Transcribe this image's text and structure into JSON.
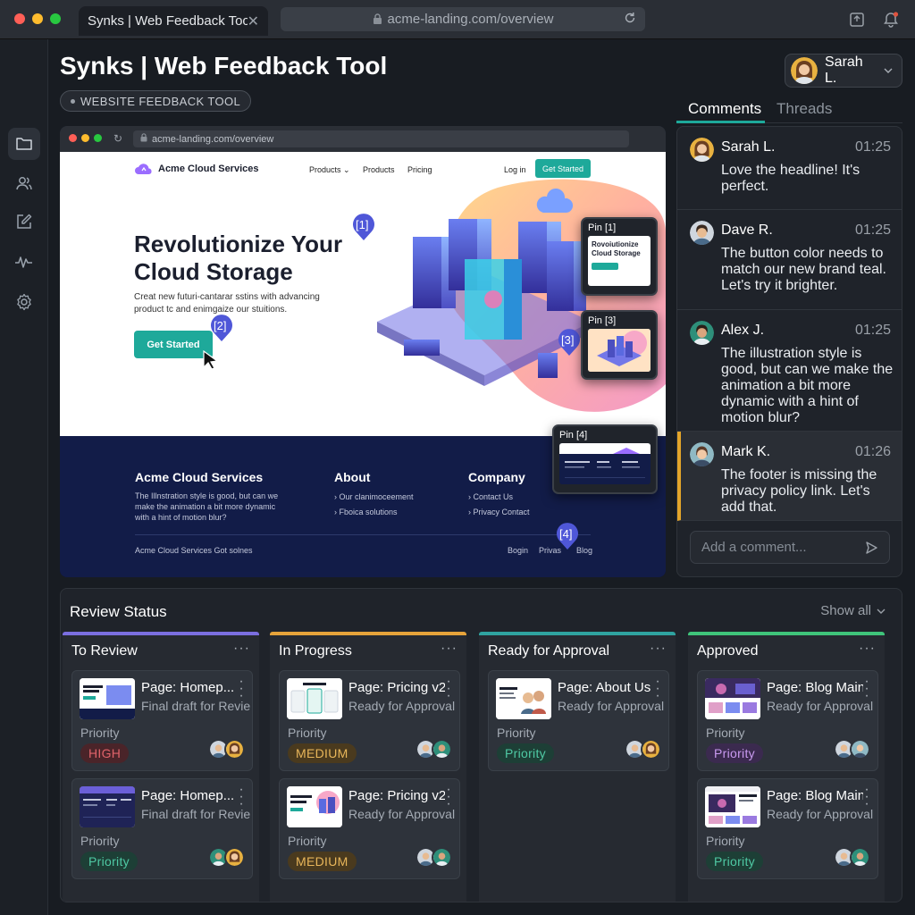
{
  "window": {
    "tab_title": "Synks | Web Feedback Tool",
    "url": "acme-landing.com/overview"
  },
  "app": {
    "title": "Synks | Web Feedback Tool",
    "chip": "WEBSITE FEEDBACK TOOL",
    "user_name": "Sarah L."
  },
  "preview": {
    "url": "acme-landing.com/overview",
    "site": {
      "brand": "Acme Cloud Services",
      "nav": [
        "Products",
        "Products",
        "Pricing"
      ],
      "login": "Log in",
      "cta": "Get Started",
      "hero_title": "Revolutionize Your Cloud Storage",
      "hero_body": "Creat new futuri-cantarar sstins with advancing product tc and enimgaize our stuitions.",
      "hero_button": "Get Started",
      "footer": {
        "brand_title": "Acme Cloud Services",
        "brand_text": "The Illnstration style is good, but can we make the animation a bit more dynamic with a hint of motion blur?",
        "about_title": "About",
        "about_links": [
          "Our clanimoceement",
          "Fboica solutions"
        ],
        "company_title": "Company",
        "company_links": [
          "Contact Us",
          "Privacy Contact"
        ],
        "bottom_left": "Acme Cloud Services   Got solnes",
        "bottom_links": [
          "Bogin",
          "Privas",
          "Blog"
        ]
      }
    },
    "pins": [
      {
        "marker": "[1]",
        "card_title": "Pin [1]",
        "card_text": "Rovoiutionize Cloud Storage"
      },
      {
        "marker": "[2]"
      },
      {
        "marker": "[3]",
        "card_title": "Pin [3]"
      },
      {
        "marker": "[4]",
        "card_title": "Pin [4]"
      }
    ]
  },
  "comments": {
    "tabs": [
      "Comments",
      "Threads"
    ],
    "items": [
      {
        "author": "Sarah L.",
        "time": "01:25",
        "text": "Love the headline! It's perfect."
      },
      {
        "author": "Dave R.",
        "time": "01:25",
        "text": "The button color needs to match our new brand teal. Let's try it brighter."
      },
      {
        "author": "Alex J.",
        "time": "01:25",
        "text": "The illustration style is good, but can we make the animation a bit more dynamic with a hint of motion blur?"
      },
      {
        "author": "Mark K.",
        "time": "01:26",
        "text": "The footer is missing the privacy policy link. Let's add that."
      }
    ],
    "input_placeholder": "Add a comment..."
  },
  "review": {
    "title": "Review Status",
    "show_all": "Show all",
    "columns": [
      {
        "title": "To Review",
        "color": "#7b6fe0",
        "cards": [
          {
            "title": "Page: Homep...",
            "subtitle": "Final draft for Review",
            "priority_label": "Priority",
            "badge": "HIGH",
            "badge_color": "#e0636a",
            "badge_bg": "#4a2429"
          },
          {
            "title": "Page: Homep...",
            "subtitle": "Final draft for Review",
            "priority_label": "Priority",
            "badge": "Priority",
            "badge_color": "#4fc9a4",
            "badge_bg": "#1d3f36"
          }
        ]
      },
      {
        "title": "In Progress",
        "color": "#e6a33a",
        "cards": [
          {
            "title": "Page: Pricing v2",
            "subtitle": "Ready for Approval",
            "priority_label": "Priority",
            "badge": "MEDIUM",
            "badge_color": "#e8b65a",
            "badge_bg": "#4a3a1e"
          },
          {
            "title": "Page: Pricing v2",
            "subtitle": "Ready for Approval",
            "priority_label": "Priority",
            "badge": "MEDIUM",
            "badge_color": "#e8b65a",
            "badge_bg": "#4a3a1e"
          }
        ]
      },
      {
        "title": "Ready for Approval",
        "color": "#2fa3a0",
        "cards": [
          {
            "title": "Page: About Us",
            "subtitle": "Ready for Approval",
            "priority_label": "Priority",
            "badge": "Priority",
            "badge_color": "#4fc9a4",
            "badge_bg": "#1d3f36"
          }
        ]
      },
      {
        "title": "Approved",
        "color": "#3fc47a",
        "cards": [
          {
            "title": "Page: Blog Main",
            "subtitle": "Ready for Approval",
            "priority_label": "Priority",
            "badge": "Priority",
            "badge_color": "#c99af0",
            "badge_bg": "#3b2a4f"
          },
          {
            "title": "Page: Blog Main",
            "subtitle": "Ready for Approval",
            "priority_label": "Priority",
            "badge": "Priority",
            "badge_color": "#4fc9a4",
            "badge_bg": "#1d3f36"
          }
        ]
      }
    ]
  }
}
